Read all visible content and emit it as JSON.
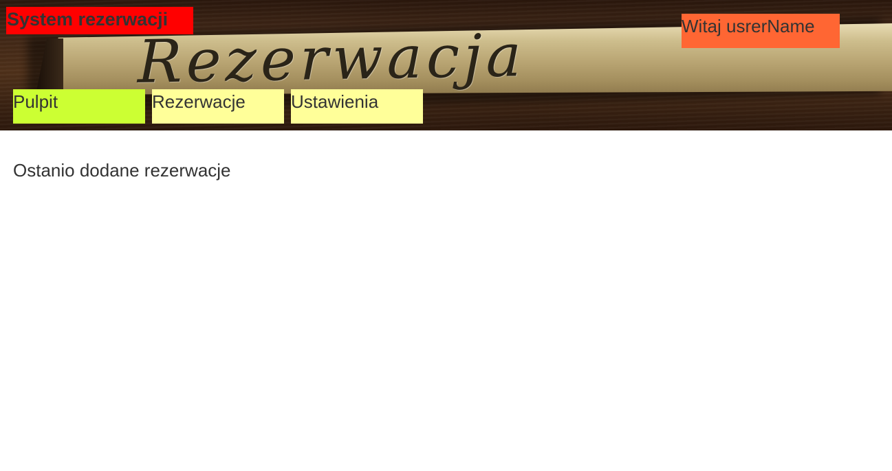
{
  "header": {
    "banner_text": "Rezerwacja",
    "app_title": "System rezerwacji",
    "welcome": "Witaj usrerName",
    "colors": {
      "app_title_bg": "#ff0000",
      "welcome_bg": "#ff6633",
      "active_tab_bg": "#ccff33",
      "tab_bg": "#ffff99"
    }
  },
  "nav": {
    "tabs": [
      {
        "label": "Pulpit",
        "active": true
      },
      {
        "label": "Rezerwacje",
        "active": false
      },
      {
        "label": "Ustawienia",
        "active": false
      }
    ]
  },
  "main": {
    "heading": "Ostanio dodane rezerwacje"
  }
}
